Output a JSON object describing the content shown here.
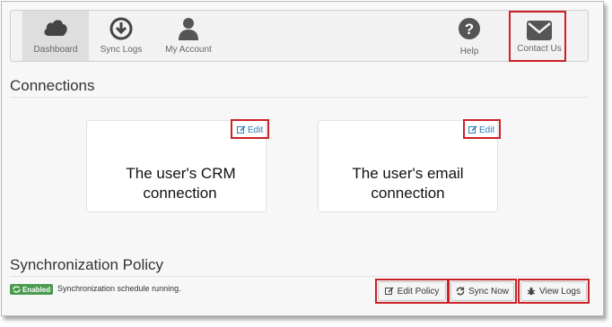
{
  "nav": {
    "items": [
      {
        "label": "Dashboard",
        "icon": "cloud-icon",
        "active": true
      },
      {
        "label": "Sync Logs",
        "icon": "download-circle-icon"
      },
      {
        "label": "My Account",
        "icon": "user-icon"
      },
      {
        "label": "Help",
        "icon": "question-circle-icon"
      },
      {
        "label": "Contact Us",
        "icon": "envelope-icon"
      }
    ]
  },
  "connections": {
    "title": "Connections",
    "cards": [
      {
        "text_line1": "The user's CRM",
        "text_line2": "connection",
        "edit_label": "Edit"
      },
      {
        "text_line1": "The user's email",
        "text_line2": "connection",
        "edit_label": "Edit"
      }
    ]
  },
  "sync_policy": {
    "title": "Synchronization Policy",
    "badge": "Enabled",
    "status": "Synchronization schedule running.",
    "buttons": {
      "edit_policy": "Edit Policy",
      "sync_now": "Sync Now",
      "view_logs": "View Logs"
    }
  },
  "colors": {
    "highlight": "#cc2127",
    "link": "#2a7ab5",
    "badge": "#4a9b4e"
  }
}
